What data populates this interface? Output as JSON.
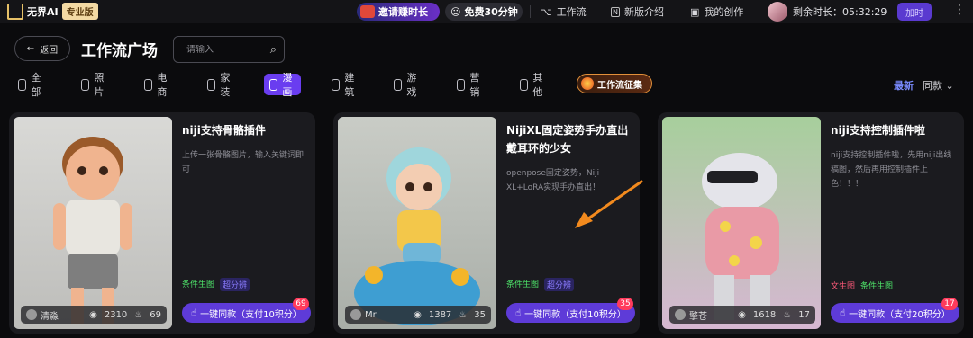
{
  "topbar": {
    "logo_text": "无界AI",
    "pro_badge": "专业版",
    "invite_label": "邀请赚时长",
    "free_label": "免费30分钟",
    "nav": [
      {
        "label": "工作流"
      },
      {
        "label": "新版介绍"
      },
      {
        "label": "我的创作"
      }
    ],
    "remaining_label": "剩余时长：05:32:29",
    "add_time_label": "加时",
    "more_label": "⋮"
  },
  "header": {
    "back_label": "返回",
    "page_title": "工作流广场",
    "search_placeholder": "请输入"
  },
  "categories": [
    {
      "label": "全部",
      "active": false
    },
    {
      "label": "照片",
      "active": false
    },
    {
      "label": "电商",
      "active": false
    },
    {
      "label": "家装",
      "active": false
    },
    {
      "label": "漫画",
      "active": true
    },
    {
      "label": "建筑",
      "active": false
    },
    {
      "label": "游戏",
      "active": false
    },
    {
      "label": "营销",
      "active": false
    },
    {
      "label": "其他",
      "active": false
    }
  ],
  "workflow_cert_label": "工作流征集",
  "sort": {
    "latest": "最新",
    "same": "同款"
  },
  "cards": [
    {
      "title": "niji支持骨骼插件",
      "desc": "上传一张骨骼图片，输入关键词即可",
      "tags": [
        {
          "text": "条件生图",
          "kind": "g"
        },
        {
          "text": "超分辨",
          "kind": "p"
        }
      ],
      "owner": "清淼",
      "views": "2310",
      "likes": "69",
      "clone_label": "一键同款（支付10积分）",
      "badge": "69"
    },
    {
      "title": "NijiXL固定姿势手办直出戴耳环的少女",
      "desc": "openpose固定姿势，Niji XL+LoRA实现手办直出！",
      "tags": [
        {
          "text": "条件生图",
          "kind": "g"
        },
        {
          "text": "超分辨",
          "kind": "p"
        }
      ],
      "owner": "Mr",
      "views": "1387",
      "likes": "35",
      "clone_label": "一键同款（支付10积分）",
      "badge": "35"
    },
    {
      "title": "niji支持控制插件啦",
      "desc": "niji支持控制插件啦，先用niji出线稿图，然后再用控制插件上色！！！",
      "tags": [
        {
          "text": "文生图",
          "kind": "r"
        },
        {
          "text": "条件生图",
          "kind": "g"
        }
      ],
      "owner": "擎苍",
      "views": "1618",
      "likes": "17",
      "clone_label": "一键同款（支付20积分）",
      "badge": "17"
    }
  ]
}
